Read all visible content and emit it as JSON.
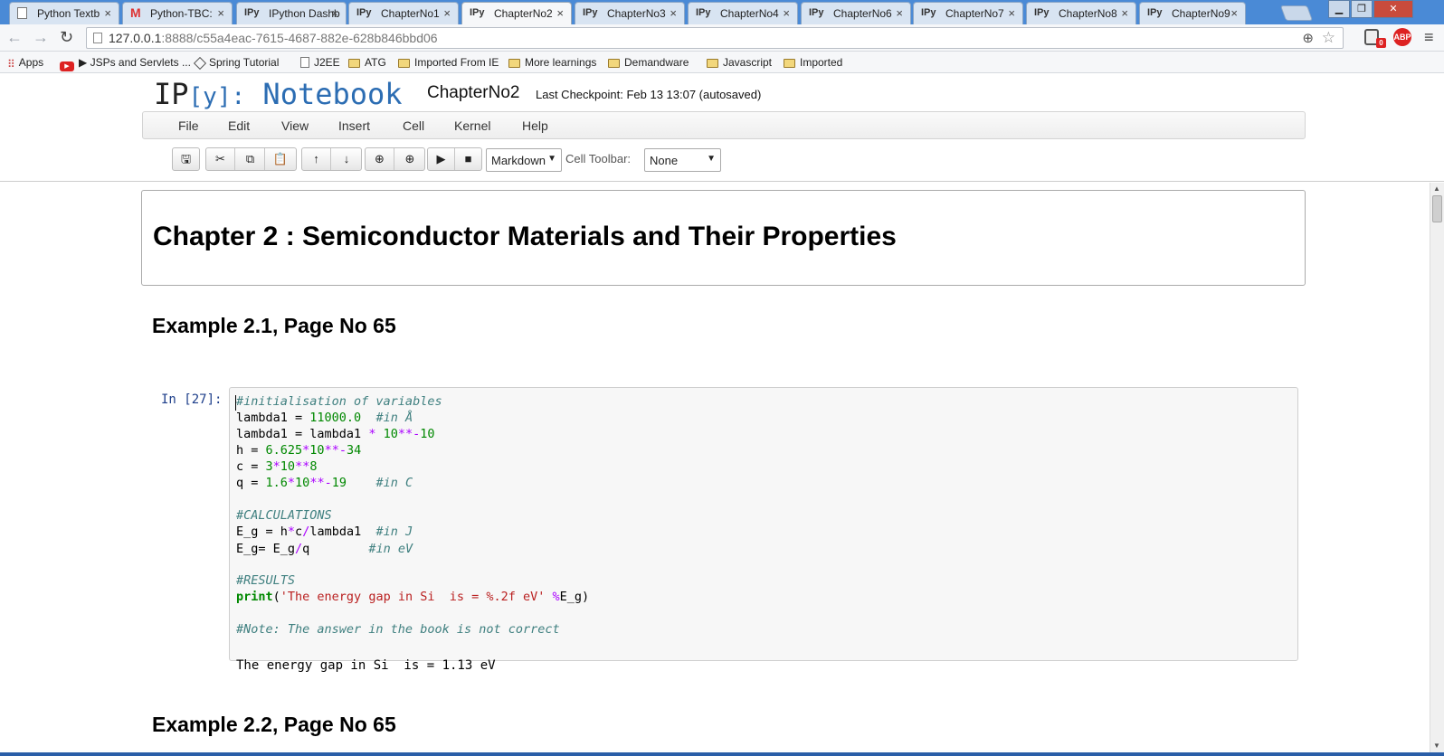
{
  "browser": {
    "tabs": [
      {
        "label": "Python Textb",
        "icon": "page-icon"
      },
      {
        "label": "Python-TBC:",
        "icon": "gmail-icon"
      },
      {
        "label": "IPython Dashb",
        "icon": "ipy-icon"
      },
      {
        "label": "ChapterNo1",
        "icon": "ipy-icon"
      },
      {
        "label": "ChapterNo2",
        "icon": "ipy-icon",
        "active": true
      },
      {
        "label": "ChapterNo3",
        "icon": "ipy-icon"
      },
      {
        "label": "ChapterNo4",
        "icon": "ipy-icon"
      },
      {
        "label": "ChapterNo6",
        "icon": "ipy-icon"
      },
      {
        "label": "ChapterNo7",
        "icon": "ipy-icon"
      },
      {
        "label": "ChapterNo8",
        "icon": "ipy-icon"
      },
      {
        "label": "ChapterNo9",
        "icon": "ipy-icon"
      }
    ],
    "ipy_prefix": "IPy",
    "tab_close": "×",
    "url_host": "127.0.0.1",
    "url_rest": ":8888/c55a4eac-7615-4687-882e-628b846bbd06",
    "ext_badge_count": "0",
    "ext_abp": "ABP",
    "bookmarks": [
      {
        "label": "Apps",
        "icon": "apps-icon"
      },
      {
        "label": "▶ JSPs and Servlets ...",
        "icon": "youtube-icon"
      },
      {
        "label": "Spring Tutorial",
        "icon": "diamond-icon"
      },
      {
        "label": "J2EE",
        "icon": "page-icon"
      },
      {
        "label": "ATG",
        "icon": "folder-icon"
      },
      {
        "label": "Imported From IE",
        "icon": "folder-icon"
      },
      {
        "label": "More learnings",
        "icon": "folder-icon"
      },
      {
        "label": "Demandware",
        "icon": "folder-icon"
      },
      {
        "label": "Javascript",
        "icon": "folder-icon"
      },
      {
        "label": "Imported",
        "icon": "folder-icon"
      }
    ]
  },
  "notebook": {
    "logo_ip": "IP",
    "logo_y": "[y]:",
    "logo_notebook": "Notebook",
    "name": "ChapterNo2",
    "checkpoint": "Last Checkpoint: Feb 13 13:07 (autosaved)",
    "menu": [
      "File",
      "Edit",
      "View",
      "Insert",
      "Cell",
      "Kernel",
      "Help"
    ],
    "cell_type": "Markdown",
    "cell_toolbar_label": "Cell Toolbar:",
    "cell_toolbar_value": "None"
  },
  "content": {
    "chapter_title": "Chapter 2 : Semiconductor Materials and Their Properties",
    "example1_heading": "Example 2.1, Page No 65",
    "prompt": "In [27]:",
    "output": "The energy gap in Si  is = 1.13 eV",
    "example2_heading": "Example 2.2, Page No 65"
  },
  "colors": {
    "tabstrip": "#4a8ad6",
    "logo_blue": "#2c6db3",
    "prompt_blue": "#1d3e8a",
    "comment": "#408080",
    "number": "#008800",
    "operator": "#aa00ff",
    "string": "#ba2121"
  }
}
